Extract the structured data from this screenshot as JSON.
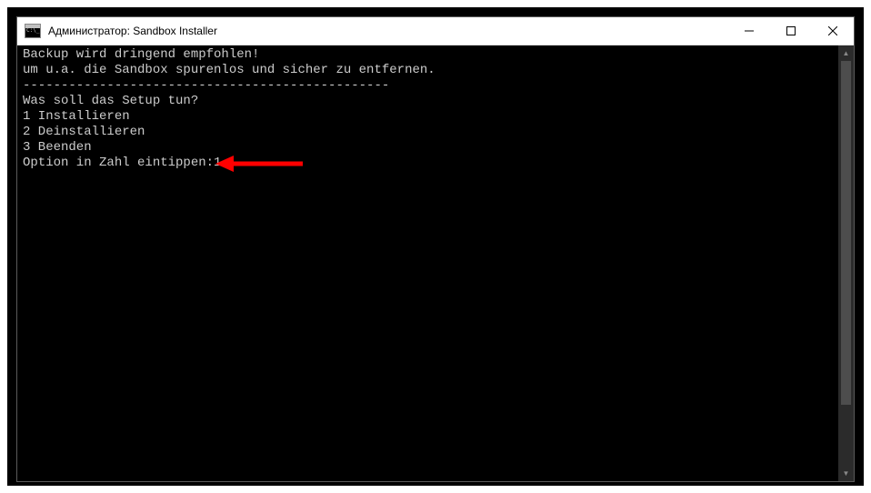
{
  "titlebar": {
    "title": "Администратор:  Sandbox Installer"
  },
  "console": {
    "line1": "Backup wird dringend empfohlen!",
    "line2": "um u.a. die Sandbox spurenlos und sicher zu entfernen.",
    "divider": "------------------------------------------------",
    "prompt_q": "Was soll das Setup tun?",
    "opt1": "1 Installieren",
    "opt2": "2 Deinstallieren",
    "opt3": "3 Beenden",
    "input_label": "Option in Zahl eintippen:",
    "input_value": "1"
  }
}
